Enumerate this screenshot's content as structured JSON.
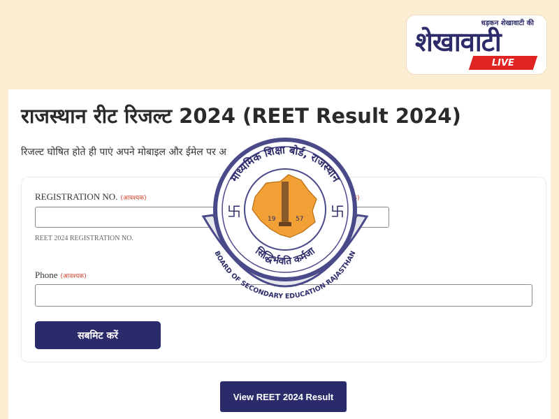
{
  "logo": {
    "tagline": "धड़कन शेखावाटी की",
    "brand": "शेखावाटी",
    "live": "LIVE"
  },
  "page": {
    "title": "राजस्थान रीट रिजल्ट 2024 (REET Result 2024)",
    "subtitle": "रिजल्ट घोषित होते ही पाएं अपने मोबाइल और ईमेल पर अ"
  },
  "form": {
    "registration_label": "REGISTRATION NO.",
    "required_text": "(आवश्यक)",
    "registration_value": "",
    "registration_help": "REET 2024 REGISTRATION NO.",
    "second_field_required_text": "श्यक)",
    "second_field_value": "",
    "phone_label": "Phone",
    "phone_value": "",
    "submit_label": "सबमिट करें"
  },
  "view_result_button": "View REET 2024 Result",
  "seal": {
    "top_text": "माध्यमिक शिक्षा बोर्ड, राजस्थान",
    "bottom_text": "सिद्धिर्भवति कर्मजा",
    "year_left": "19",
    "year_right": "57",
    "ribbon_text": "BOARD OF SECONDARY EDUCATION RAJASTHAN",
    "colors": {
      "map": "#f0a035",
      "ring": "#4a4a8a",
      "swastika": "#2c2c6b"
    }
  },
  "colors": {
    "background": "#fbeed3",
    "primary_button": "#2b2b6b",
    "live_badge": "#e02424",
    "required": "#d0402a"
  }
}
